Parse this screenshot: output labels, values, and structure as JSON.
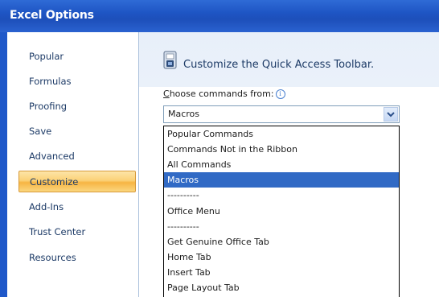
{
  "window": {
    "title": "Excel Options"
  },
  "sidebar": {
    "items": [
      {
        "label": "Popular"
      },
      {
        "label": "Formulas"
      },
      {
        "label": "Proofing"
      },
      {
        "label": "Save"
      },
      {
        "label": "Advanced"
      },
      {
        "label": "Customize",
        "selected": true
      },
      {
        "label": "Add-Ins"
      },
      {
        "label": "Trust Center"
      },
      {
        "label": "Resources"
      }
    ]
  },
  "main": {
    "header_title": "Customize the Quick Access Toolbar.",
    "choose_label_first": "C",
    "choose_label_rest": "hoose commands from:",
    "info_icon_glyph": "i",
    "combo_value": "Macros",
    "dropdown_items": [
      {
        "label": "Popular Commands"
      },
      {
        "label": "Commands Not in the Ribbon"
      },
      {
        "label": "All Commands"
      },
      {
        "label": "Macros",
        "selected": true
      },
      {
        "label": "----------"
      },
      {
        "label": "Office Menu"
      },
      {
        "label": "----------"
      },
      {
        "label": "Get Genuine Office Tab"
      },
      {
        "label": "Home Tab"
      },
      {
        "label": "Insert Tab"
      },
      {
        "label": "Page Layout Tab"
      }
    ]
  },
  "colors": {
    "titlebar": "#1f58c9",
    "selected_nav": "#f7b543",
    "selected_list": "#316ac5",
    "text_nav": "#1c3a66"
  }
}
